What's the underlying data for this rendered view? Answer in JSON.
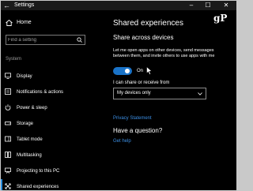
{
  "titlebar": {
    "back_glyph": "←",
    "title": "Settings",
    "minimize_glyph": "–",
    "maximize_glyph": "☐",
    "close_glyph": "✕"
  },
  "sidebar": {
    "home_label": "Home",
    "search_placeholder": "Find a setting",
    "section_label": "System",
    "items": [
      {
        "label": "Display",
        "icon": "display-icon",
        "active": false
      },
      {
        "label": "Notifications & actions",
        "icon": "notifications-icon",
        "active": false
      },
      {
        "label": "Power & sleep",
        "icon": "power-icon",
        "active": false
      },
      {
        "label": "Storage",
        "icon": "storage-icon",
        "active": false
      },
      {
        "label": "Tablet mode",
        "icon": "tablet-icon",
        "active": false
      },
      {
        "label": "Multitasking",
        "icon": "multitasking-icon",
        "active": false
      },
      {
        "label": "Projecting to this PC",
        "icon": "projecting-icon",
        "active": false
      },
      {
        "label": "Shared experiences",
        "icon": "shared-experiences-icon",
        "active": true
      }
    ]
  },
  "main": {
    "title": "Shared experiences",
    "logo_text": "gP",
    "section_heading": "Share across devices",
    "description": "Let me open apps on other devices, send messages between them, and invite others to use apps with me",
    "toggle_state": "On",
    "toggle_on": true,
    "select_label": "I can share or receive from",
    "select_value": "My devices only",
    "privacy_link": "Privacy Statement",
    "question_heading": "Have a question?",
    "help_link": "Get help"
  },
  "colors": {
    "background": "#000000",
    "accent": "#1a73c8",
    "link": "#3b8ee3",
    "muted_text": "#9a9a9a"
  }
}
